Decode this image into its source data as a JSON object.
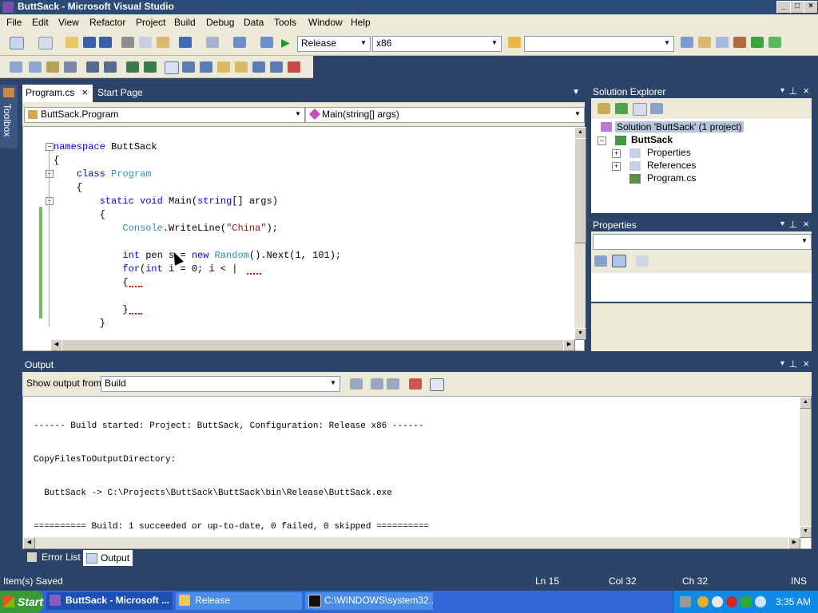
{
  "window": {
    "title": "ButtSack - Microsoft Visual Studio"
  },
  "menu": [
    "File",
    "Edit",
    "View",
    "Refactor",
    "Project",
    "Build",
    "Debug",
    "Data",
    "Tools",
    "Window",
    "Help"
  ],
  "toolbar": {
    "config": "Release",
    "platform": "x86",
    "find_value": ""
  },
  "editor": {
    "tabs": [
      "Program.cs",
      "Start Page"
    ],
    "class_dropdown": "ButtSack.Program",
    "member_dropdown": "Main(string[] args)",
    "lines": [
      {
        "parts": [
          [
            "kw",
            "namespace"
          ],
          [
            "",
            "ButtSack"
          ]
        ]
      },
      {
        "parts": [
          [
            "",
            "{"
          ]
        ]
      },
      {
        "parts": [
          [
            "",
            "    "
          ],
          [
            "kw",
            "class"
          ],
          [
            "",
            ""
          ],
          [
            "ty",
            "Program"
          ]
        ]
      },
      {
        "parts": [
          [
            "",
            "    {"
          ]
        ]
      },
      {
        "parts": [
          [
            "",
            "        "
          ],
          [
            "kw",
            "static"
          ],
          [
            "",
            ""
          ],
          [
            "kw",
            "void"
          ],
          [
            "",
            "Main("
          ],
          [
            "kw",
            "string"
          ],
          [
            "",
            "[] args)"
          ]
        ]
      },
      {
        "parts": [
          [
            "",
            "        {"
          ]
        ]
      },
      {
        "parts": [
          [
            "",
            "            "
          ],
          [
            "ty",
            "Console"
          ],
          [
            "",
            ".WriteLine("
          ],
          [
            "st",
            "\"China\""
          ],
          [
            "",
            ");"
          ]
        ]
      },
      {
        "parts": [
          [
            "",
            ""
          ]
        ]
      },
      {
        "parts": [
          [
            "",
            "            "
          ],
          [
            "kw",
            "int"
          ],
          [
            "",
            "pen s = "
          ],
          [
            "kw",
            "new"
          ],
          [
            "",
            ""
          ],
          [
            "ty",
            "Random"
          ],
          [
            "",
            "().Next(1, 101);"
          ]
        ]
      },
      {
        "parts": [
          [
            "",
            "            "
          ],
          [
            "kw",
            "for"
          ],
          [
            "",
            "("
          ],
          [
            "kw",
            "int"
          ],
          [
            "",
            "i = 0; i < |"
          ]
        ]
      },
      {
        "parts": [
          [
            "",
            "            {"
          ]
        ]
      },
      {
        "parts": [
          [
            "",
            ""
          ]
        ]
      },
      {
        "parts": [
          [
            "",
            "            }"
          ]
        ]
      },
      {
        "parts": [
          [
            "",
            "        }"
          ]
        ]
      }
    ]
  },
  "toolbox": {
    "label": "Toolbox"
  },
  "solution_explorer": {
    "title": "Solution Explorer",
    "solution": "Solution 'ButtSack' (1 project)",
    "project": "ButtSack",
    "items": [
      "Properties",
      "References",
      "Program.cs"
    ]
  },
  "properties": {
    "title": "Properties"
  },
  "output": {
    "title": "Output",
    "show_from_label": "Show output from:",
    "source": "Build",
    "lines": [
      "------ Build started: Project: ButtSack, Configuration: Release x86 ------",
      "CopyFilesToOutputDirectory:",
      "  ButtSack -> C:\\Projects\\ButtSack\\ButtSack\\bin\\Release\\ButtSack.exe",
      "========== Build: 1 succeeded or up-to-date, 0 failed, 0 skipped =========="
    ]
  },
  "bottom_tabs": [
    "Error List",
    "Output"
  ],
  "status": {
    "message": "Item(s) Saved",
    "ln": "Ln 15",
    "col": "Col 32",
    "ch": "Ch 32",
    "mode": "INS"
  },
  "taskbar": {
    "start": "Start",
    "buttons": [
      "ButtSack - Microsoft ...",
      "Release",
      "C:\\WINDOWS\\system32..."
    ],
    "clock": "3:35 AM"
  },
  "colors": {
    "keyword": "#0000ff",
    "type": "#2b91af",
    "string": "#a31515",
    "chrome": "#ece9d8",
    "panel_header": "#2d4469",
    "taskbar": "#3168d5"
  }
}
